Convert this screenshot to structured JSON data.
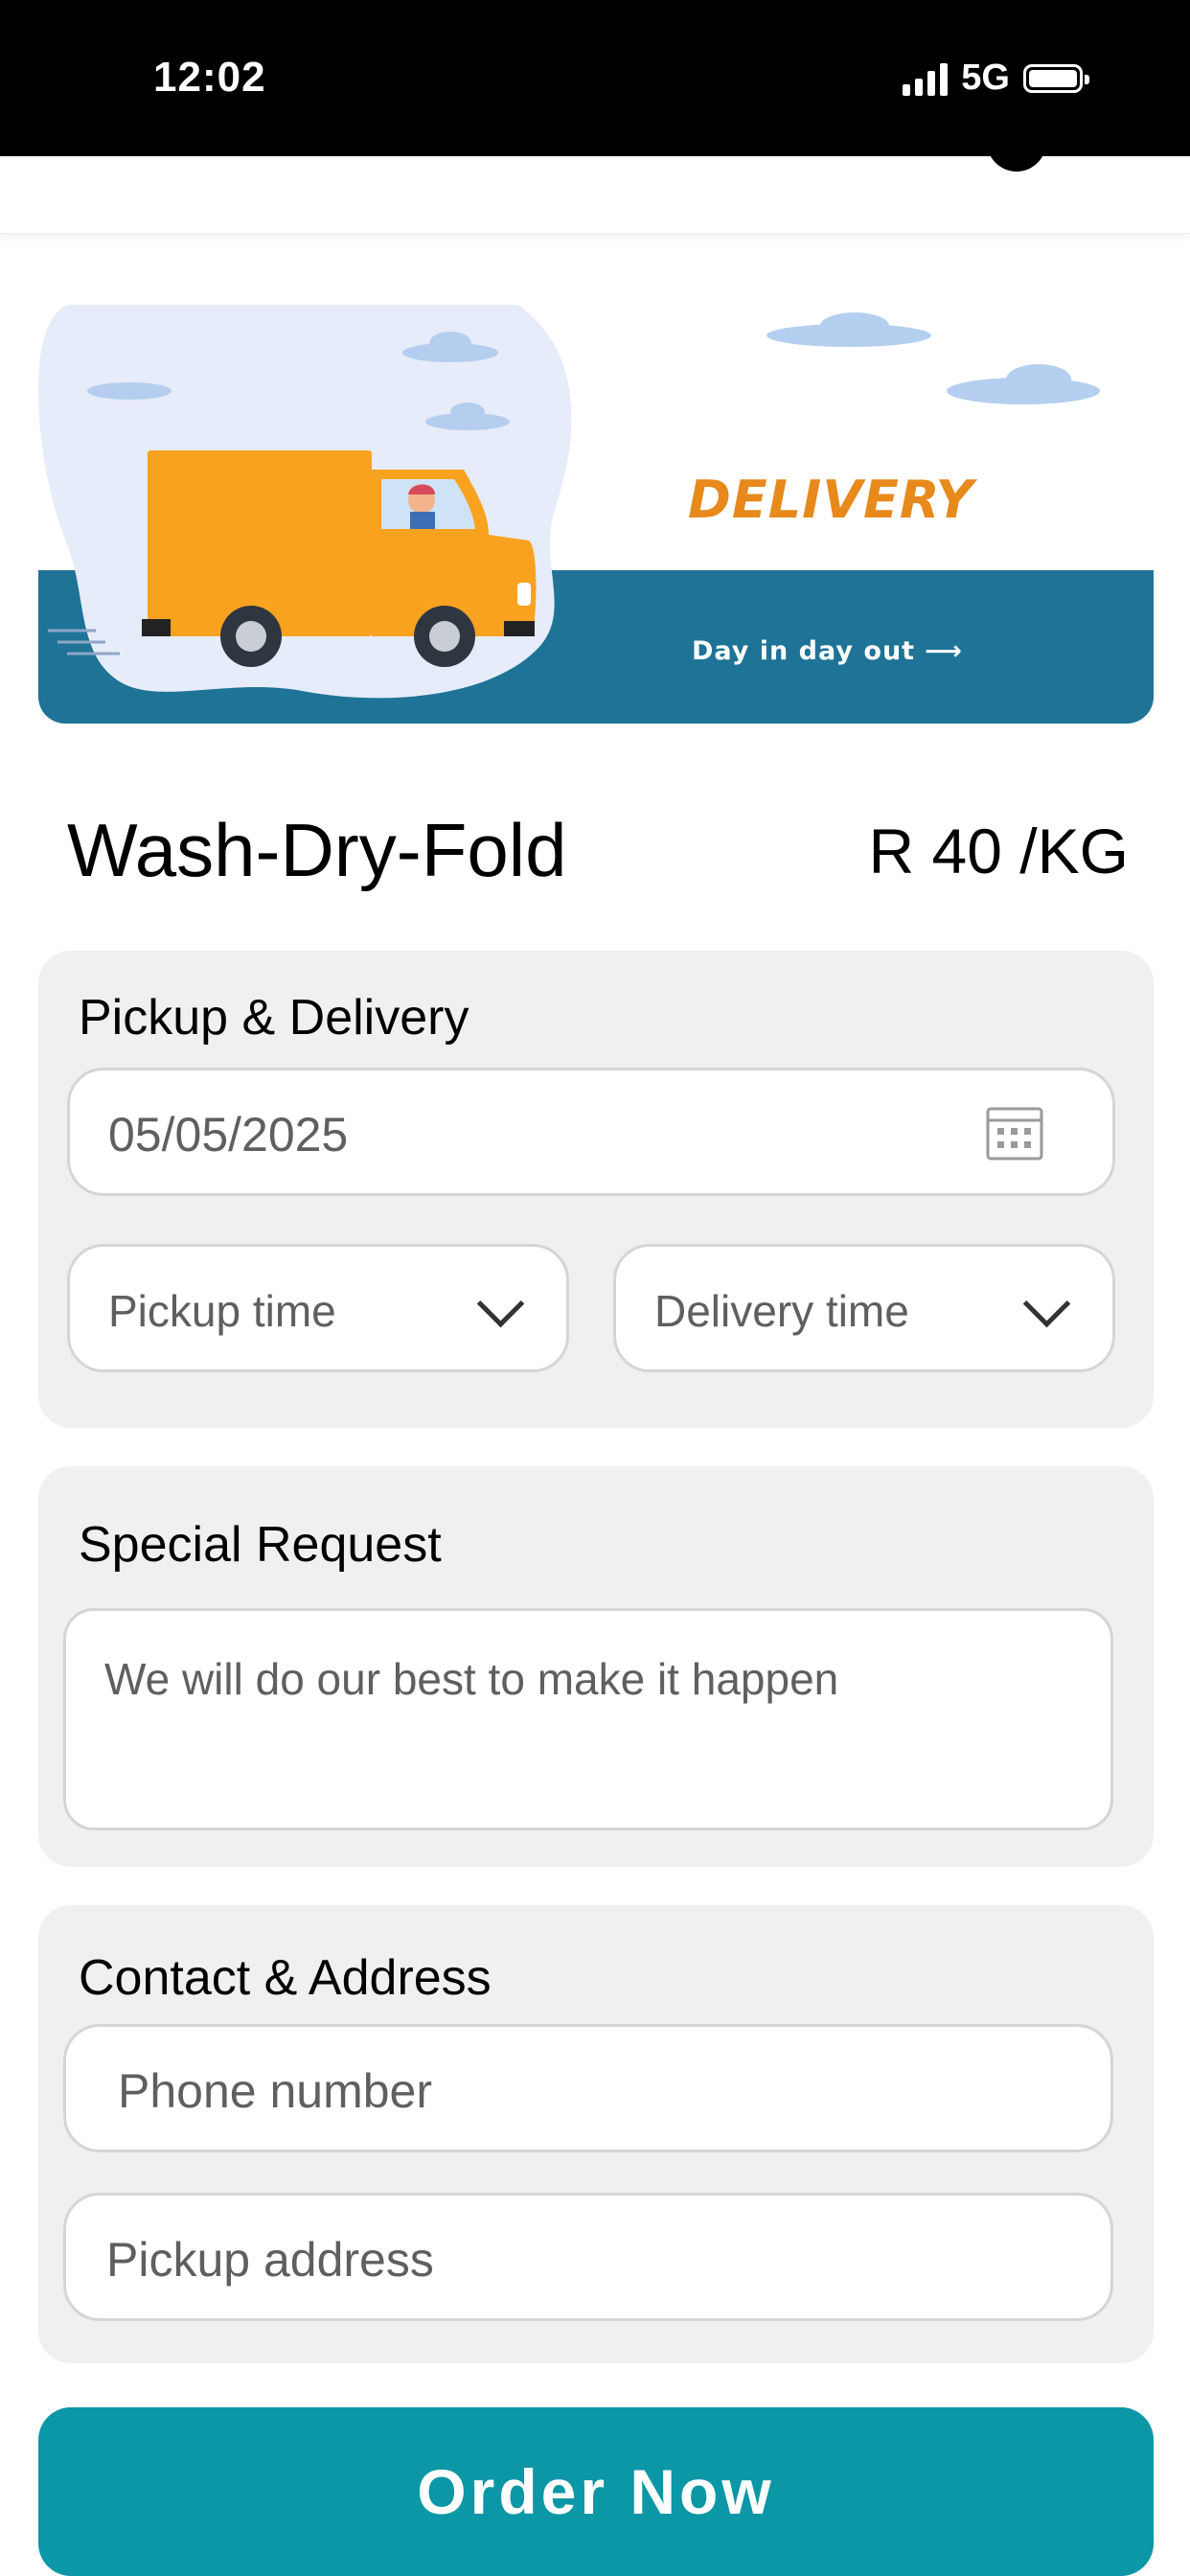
{
  "status_bar": {
    "time": "12:02",
    "network": "5G"
  },
  "banner": {
    "title": "DELIVERY",
    "tagline": "Day in day out",
    "arrow": "⟶",
    "colors": {
      "band": "#1f7396",
      "truck": "#f9a21f",
      "blob": "#e6ecf9",
      "title": "#e8891c"
    }
  },
  "product": {
    "name": "Wash-Dry-Fold",
    "price": "R 40 /KG"
  },
  "pickup_delivery": {
    "title": "Pickup & Delivery",
    "date_value": "05/05/2025",
    "pickup_time_placeholder": "Pickup time",
    "delivery_time_placeholder": "Delivery time"
  },
  "special_request": {
    "title": "Special Request",
    "placeholder": "We will do our best to make it happen"
  },
  "contact": {
    "title": "Contact & Address",
    "phone_placeholder": "Phone number",
    "address_placeholder": "Pickup address"
  },
  "order_button": {
    "label": "Order Now",
    "color": "#0b97a6"
  }
}
